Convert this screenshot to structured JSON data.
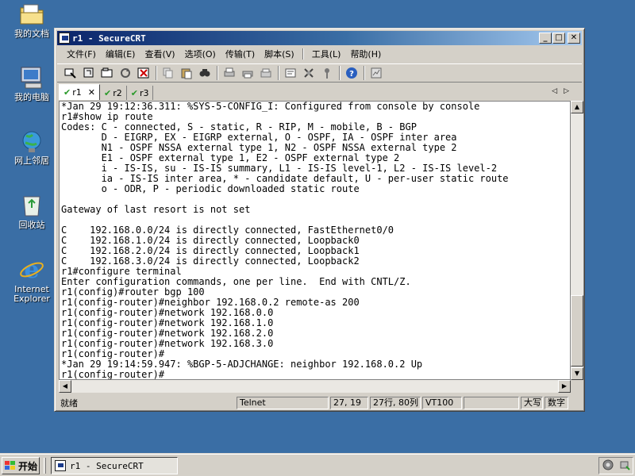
{
  "desktop": {
    "icons": [
      {
        "label": "我的文档",
        "icon": "folder-icon"
      },
      {
        "label": "我的电脑",
        "icon": "computer-icon"
      },
      {
        "label": "网上邻居",
        "icon": "network-icon"
      },
      {
        "label": "回收站",
        "icon": "recycle-bin-icon"
      },
      {
        "label": "Internet Explorer",
        "icon": "ie-icon"
      }
    ]
  },
  "window": {
    "title": "r1 - SecureCRT",
    "buttons": {
      "minimize": "_",
      "maximize": "□",
      "close": "✕"
    }
  },
  "menu": {
    "items": [
      "文件(F)",
      "编辑(E)",
      "查看(V)",
      "选项(O)",
      "传输(T)",
      "脚本(S)",
      "工具(L)",
      "帮助(H)"
    ]
  },
  "tabs": [
    {
      "label": "r1",
      "active": true
    },
    {
      "label": "r2",
      "active": false
    },
    {
      "label": "r3",
      "active": false
    }
  ],
  "terminal": {
    "lines": [
      "*Jan 29 19:12:36.311: %SYS-5-CONFIG_I: Configured from console by console",
      "r1#show ip route",
      "Codes: C - connected, S - static, R - RIP, M - mobile, B - BGP",
      "       D - EIGRP, EX - EIGRP external, O - OSPF, IA - OSPF inter area",
      "       N1 - OSPF NSSA external type 1, N2 - OSPF NSSA external type 2",
      "       E1 - OSPF external type 1, E2 - OSPF external type 2",
      "       i - IS-IS, su - IS-IS summary, L1 - IS-IS level-1, L2 - IS-IS level-2",
      "       ia - IS-IS inter area, * - candidate default, U - per-user static route",
      "       o - ODR, P - periodic downloaded static route",
      "",
      "Gateway of last resort is not set",
      "",
      "C    192.168.0.0/24 is directly connected, FastEthernet0/0",
      "C    192.168.1.0/24 is directly connected, Loopback0",
      "C    192.168.2.0/24 is directly connected, Loopback1",
      "C    192.168.3.0/24 is directly connected, Loopback2",
      "r1#configure terminal",
      "Enter configuration commands, one per line.  End with CNTL/Z.",
      "r1(config)#router bgp 100",
      "r1(config-router)#neighbor 192.168.0.2 remote-as 200",
      "r1(config-router)#network 192.168.0.0",
      "r1(config-router)#network 192.168.1.0",
      "r1(config-router)#network 192.168.2.0",
      "r1(config-router)#network 192.168.3.0",
      "r1(config-router)#",
      "*Jan 29 19:14:59.947: %BGP-5-ADJCHANGE: neighbor 192.168.0.2 Up",
      "r1(config-router)#"
    ]
  },
  "status": {
    "ready": "就绪",
    "protocol": "Telnet",
    "cursor": "27, 19",
    "size": "27行, 80列",
    "emulation": "VT100",
    "blank": "",
    "caps": "大写",
    "num": "数字"
  },
  "taskbar": {
    "start_label": "开始",
    "task_label": "r1 - SecureCRT"
  }
}
